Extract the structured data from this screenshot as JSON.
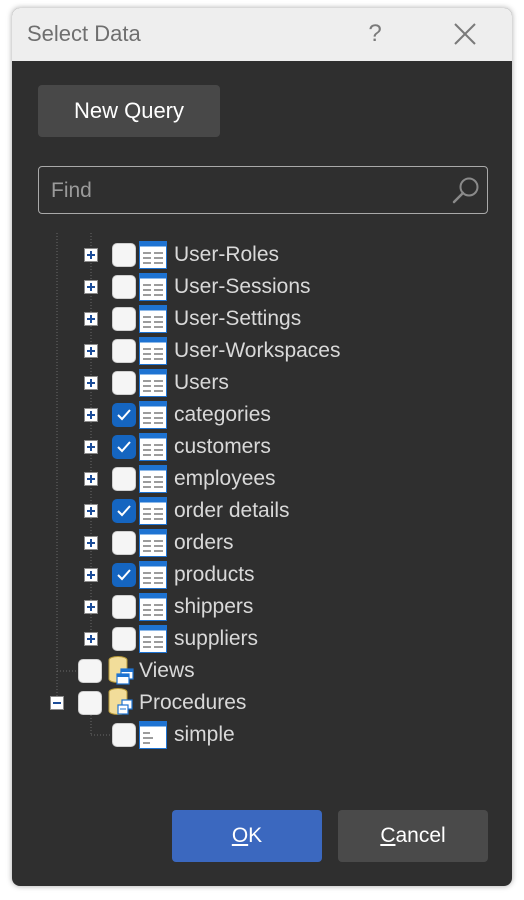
{
  "dialog": {
    "title": "Select Data",
    "help_label": "?"
  },
  "new_query_label": "New Query",
  "search": {
    "placeholder": "Find",
    "value": ""
  },
  "tree": {
    "tables": [
      {
        "label": "User-Roles",
        "checked": false
      },
      {
        "label": "User-Sessions",
        "checked": false
      },
      {
        "label": "User-Settings",
        "checked": false
      },
      {
        "label": "User-Workspaces",
        "checked": false
      },
      {
        "label": "Users",
        "checked": false
      },
      {
        "label": "categories",
        "checked": true
      },
      {
        "label": "customers",
        "checked": true
      },
      {
        "label": "employees",
        "checked": false
      },
      {
        "label": "order details",
        "checked": true
      },
      {
        "label": "orders",
        "checked": false
      },
      {
        "label": "products",
        "checked": true
      },
      {
        "label": "shippers",
        "checked": false
      },
      {
        "label": "suppliers",
        "checked": false
      }
    ],
    "views_label": "Views",
    "procedures_label": "Procedures",
    "procedures_children": [
      {
        "label": "simple",
        "checked": false
      }
    ]
  },
  "buttons": {
    "ok_accel": "O",
    "ok_rest": "K",
    "cancel_accel": "C",
    "cancel_rest": "ancel"
  },
  "colors": {
    "dialog_bg": "#2f2f2f",
    "titlebar_bg": "#eeeeee",
    "ok_button": "#3b68bf",
    "check_accent": "#1565c0",
    "table_icon_header": "#1e73d2"
  }
}
